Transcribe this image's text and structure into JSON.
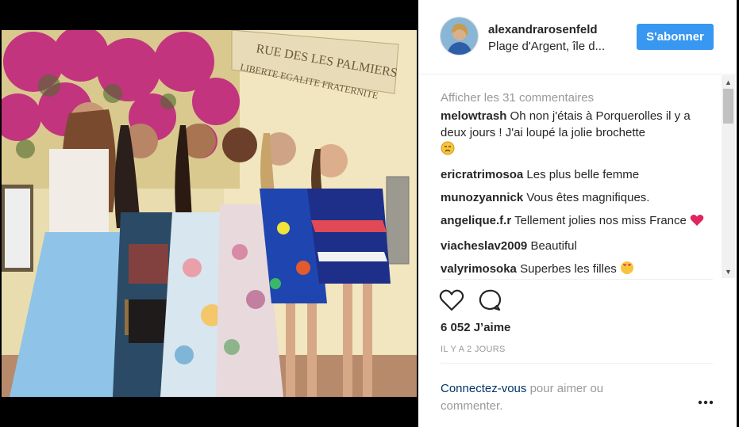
{
  "post": {
    "username": "alexandrarosenfeld",
    "location": "Plage d'Argent, île d...",
    "follow_label": "S'abonner",
    "load_more": "Afficher les 31 commentaires",
    "comments": [
      {
        "user": "melowtrash",
        "text": "Oh non j'étais à Porquerolles il y a deux jours ! J'ai loupé la jolie brochette",
        "emoji": "sleepy-face"
      },
      {
        "user": "ericratrimosoa",
        "text": "Les plus belle femme"
      },
      {
        "user": "munozyannick",
        "text": "Vous êtes magnifiques."
      },
      {
        "user": "angelique.f.r",
        "text": "Tellement jolies nos miss France",
        "emoji": "red-heart"
      },
      {
        "user": "viacheslav2009",
        "text": "Beautiful"
      },
      {
        "user": "valyrimosoka",
        "text": "Superbes les filles",
        "emoji": "heart-eyes"
      }
    ],
    "likes": "6 052 J’aime",
    "time": "IL Y A 2 JOURS",
    "login_link": "Connectez-vous",
    "login_rest": " pour aimer ou commenter."
  },
  "photo": {
    "sign_line1": "RUE DES LES PALMIERS",
    "sign_line2": "LIBERTE EGALITE FRATERNITE"
  },
  "colors": {
    "accent": "#3897f0",
    "link": "#003569",
    "text": "#262626",
    "muted": "#999999"
  }
}
